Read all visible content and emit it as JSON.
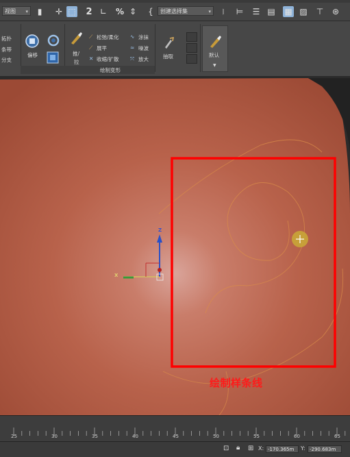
{
  "toolbar": {
    "view_dropdown": "视图",
    "selection_set_dropdown": "创建选择集",
    "snap_label": "2",
    "percent_label": "%"
  },
  "ribbon": {
    "left_items": [
      "拓扑",
      "条带",
      "分支"
    ],
    "shift_label": "偏移",
    "push_pull_label_1": "推/",
    "push_pull_label_2": "拉",
    "relax_soften_label": "松弛/柔化",
    "smudge_label": "涂抹",
    "flatten_label": "展平",
    "noise_label": "噪波",
    "pinch_spread_label": "收缩/扩散",
    "exaggerate_label": "放大",
    "revert_label": "抽取",
    "default_label": "默认",
    "group_title": "绘制变形"
  },
  "viewport": {
    "annotation_text": "绘制样条线",
    "annotation_color": "#ff1a1a",
    "highlight_box_color": "#ff0000",
    "axis_z_label": "Z",
    "axis_x_label": "X"
  },
  "timeline": {
    "tick_labels": [
      "25",
      "30",
      "35",
      "40",
      "45",
      "50",
      "55",
      "60",
      "65"
    ]
  },
  "status": {
    "x_value": "-170.365m",
    "y_value": "-290.683m"
  }
}
